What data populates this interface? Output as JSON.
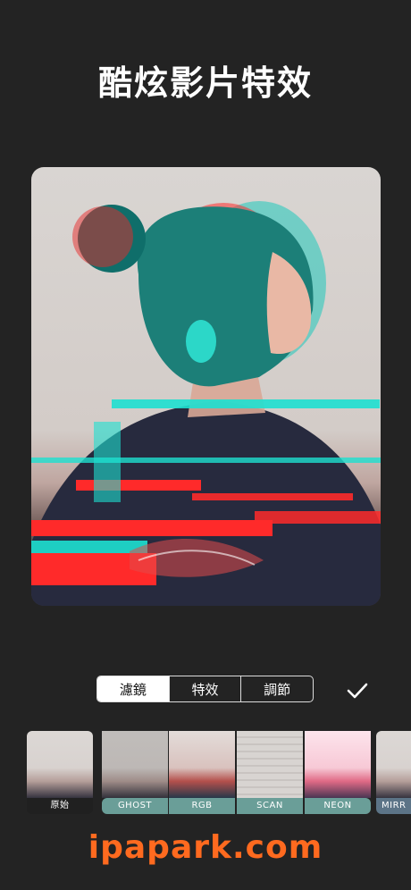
{
  "header": {
    "title": "酷炫影片特效"
  },
  "preview": {
    "image": "glitch-portrait",
    "effect_colors": [
      "#ff2a2a",
      "#1ee0d0"
    ]
  },
  "tabs": [
    {
      "label": "濾鏡",
      "active": true
    },
    {
      "label": "特效",
      "active": false
    },
    {
      "label": "調節",
      "active": false
    }
  ],
  "confirm": {
    "icon": "checkmark-icon"
  },
  "filters": {
    "original_label": "原始",
    "items": [
      "GHOST",
      "RGB",
      "SCAN",
      "NEON",
      "MIRR"
    ]
  },
  "colors": {
    "accent": "#6a9e98",
    "background": "#232323",
    "watermark": "#ff6a1f"
  },
  "watermark": "ipapark.com"
}
